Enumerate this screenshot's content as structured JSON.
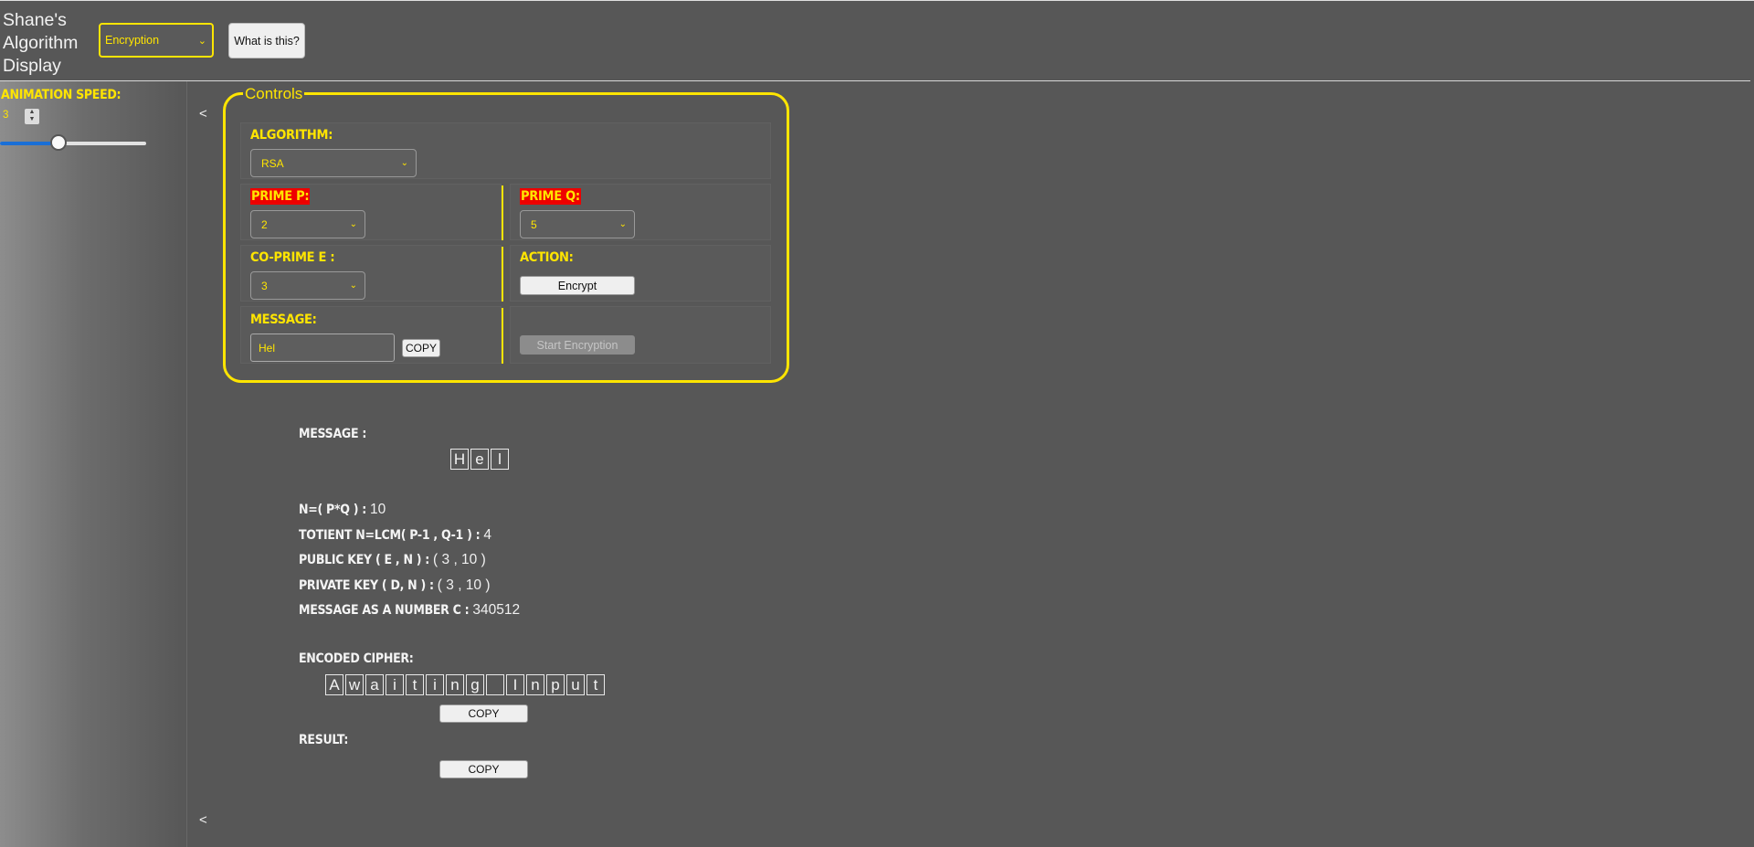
{
  "header": {
    "title": "Shane's Algorithm Display",
    "mode_select": "Encryption",
    "what_is_this": "What is this?"
  },
  "sidebar": {
    "animation_speed_label": "ANIMATION SPEED:",
    "speed_value": "3",
    "slider_fraction": 0.4,
    "collapse_arrow": "<"
  },
  "controls": {
    "legend": "Controls",
    "algorithm_label": "ALGORITHM:",
    "algorithm_value": "RSA",
    "prime_p_label": "PRIME P:",
    "prime_p_value": "2",
    "prime_q_label": "PRIME Q:",
    "prime_q_value": "5",
    "coprime_e_label": "CO-PRIME E :",
    "coprime_e_value": "3",
    "action_label": "ACTION:",
    "action_button": "Encrypt",
    "message_label": "MESSAGE:",
    "message_value": "Hel",
    "copy_button": "COPY",
    "start_button": "Start Encryption"
  },
  "output": {
    "message_label": "MESSAGE :",
    "message_chars": [
      "H",
      "e",
      "l"
    ],
    "n_label": "N=( P*Q ) :",
    "n_value": "10",
    "totient_label": "TOTIENT N=LCM( P-1 , Q-1 ) :",
    "totient_value": "4",
    "public_key_label": "PUBLIC KEY ( E , N ) :",
    "public_key_value": "( 3 , 10 )",
    "private_key_label": "PRIVATE KEY ( D, N ) :",
    "private_key_value": "( 3 , 10 )",
    "number_label": "MESSAGE AS A NUMBER C :",
    "number_value": "340512",
    "cipher_label": "ENCODED CIPHER:",
    "cipher_chars": [
      "A",
      "w",
      "a",
      "i",
      "t",
      "i",
      "n",
      "g",
      " ",
      "I",
      "n",
      "p",
      "u",
      "t"
    ],
    "cipher_copy": "COPY",
    "result_label": "RESULT:",
    "result_copy": "COPY",
    "bottom_arrow": "<"
  }
}
